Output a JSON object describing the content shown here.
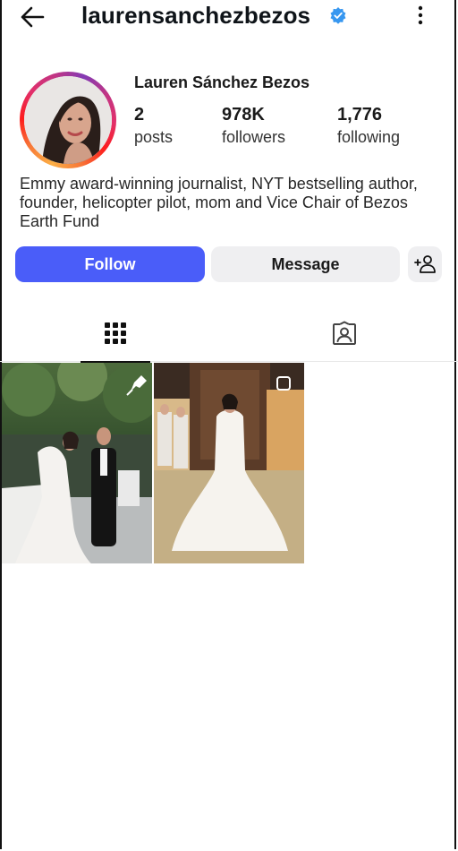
{
  "header": {
    "handle": "laurensanchezbezos",
    "back_icon": "arrow-left-icon",
    "verified_icon": "verified-badge-icon",
    "verified_color": "#3797f0",
    "more_icon": "more-vertical-icon"
  },
  "profile": {
    "full_name": "Lauren Sánchez Bezos",
    "stats": {
      "posts_count": "2",
      "posts_label": "posts",
      "followers_count": "978K",
      "followers_label": "followers",
      "following_count": "1,776",
      "following_label": "following"
    },
    "bio": "Emmy award-winning journalist, NYT bestselling author, founder, helicopter pilot, mom and Vice Chair of Bezos Earth Fund"
  },
  "actions": {
    "follow_label": "Follow",
    "message_label": "Message",
    "add_user_icon": "add-user-icon",
    "follow_color": "#4a5df9"
  },
  "tabs": [
    {
      "icon": "grid-icon",
      "selected": true
    },
    {
      "icon": "tagged-user-icon",
      "selected": false
    }
  ],
  "posts": [
    {
      "icon_overlay": "pin-icon"
    },
    {
      "icon_overlay": "multi-image-icon"
    }
  ]
}
